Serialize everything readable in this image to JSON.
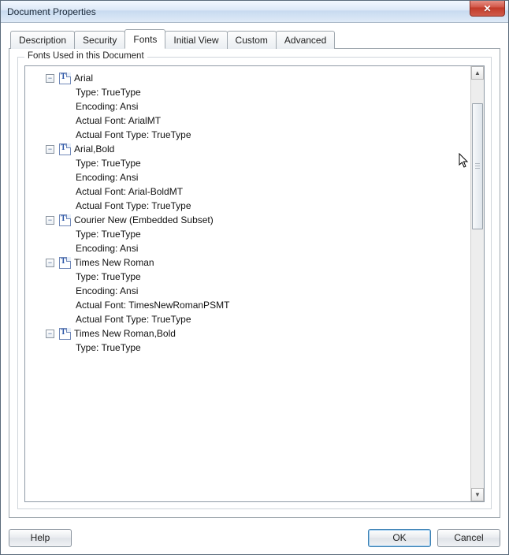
{
  "window": {
    "title": "Document Properties"
  },
  "tabs": {
    "t0": "Description",
    "t1": "Security",
    "t2": "Fonts",
    "t3": "Initial View",
    "t4": "Custom",
    "t5": "Advanced",
    "active": "t2"
  },
  "group_title": "Fonts Used in this Document",
  "glyphs": {
    "minus": "−",
    "up": "▲",
    "down": "▼"
  },
  "buttons": {
    "help": "Help",
    "ok": "OK",
    "cancel": "Cancel"
  },
  "fonts": [
    {
      "name": "Arial",
      "details": [
        "Type: TrueType",
        "Encoding: Ansi",
        "Actual Font: ArialMT",
        "Actual Font Type: TrueType"
      ]
    },
    {
      "name": "Arial,Bold",
      "details": [
        "Type: TrueType",
        "Encoding: Ansi",
        "Actual Font: Arial-BoldMT",
        "Actual Font Type: TrueType"
      ]
    },
    {
      "name": "Courier New (Embedded Subset)",
      "details": [
        "Type: TrueType",
        "Encoding: Ansi"
      ]
    },
    {
      "name": "Times New Roman",
      "details": [
        "Type: TrueType",
        "Encoding: Ansi",
        "Actual Font: TimesNewRomanPSMT",
        "Actual Font Type: TrueType"
      ]
    },
    {
      "name": "Times New Roman,Bold",
      "details": [
        "Type: TrueType"
      ]
    }
  ]
}
